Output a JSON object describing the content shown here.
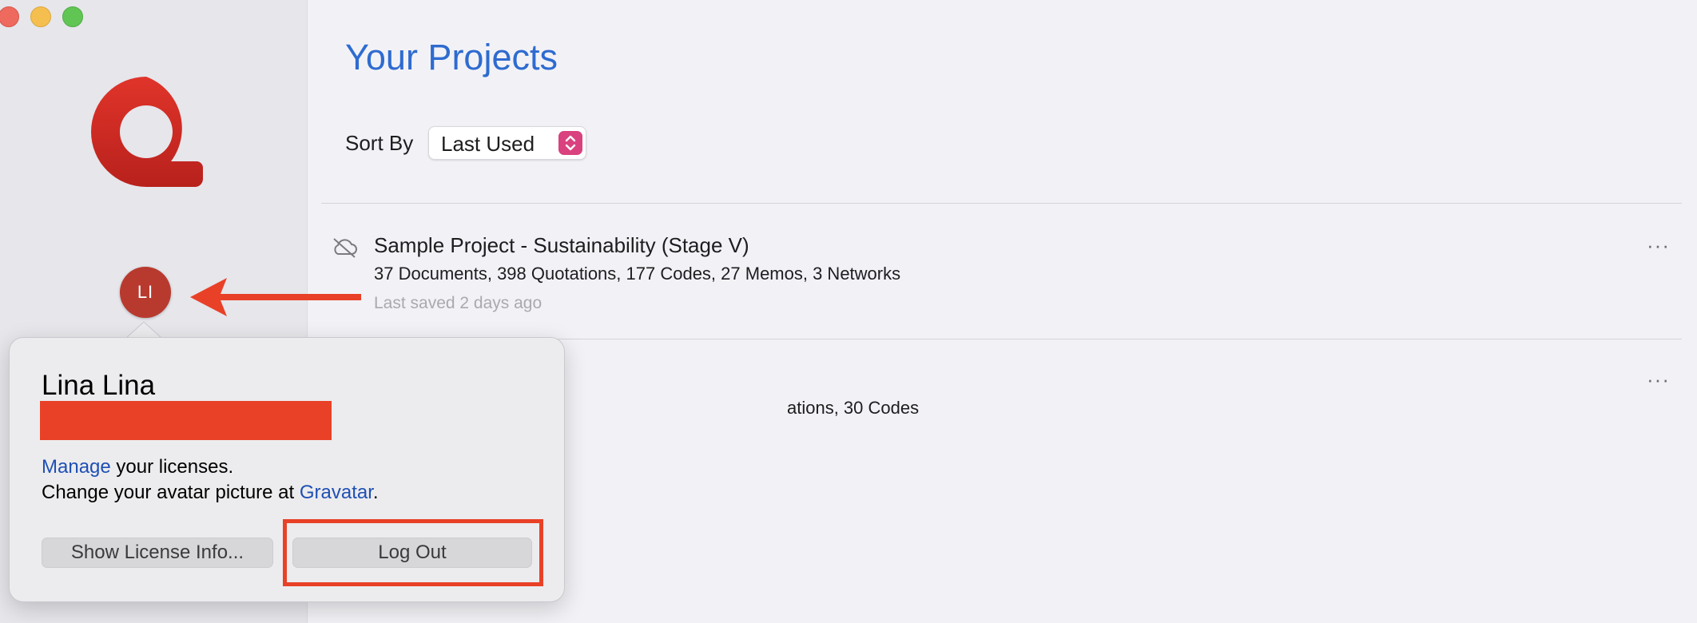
{
  "window": {
    "controls": [
      "close",
      "minimize",
      "zoom"
    ]
  },
  "sidebar": {
    "logo_icon": "atlas-at-logo-icon",
    "avatar_initials": "LI"
  },
  "main": {
    "title": "Your Projects",
    "sort_label": "Sort By",
    "sort_value": "Last Used",
    "projects": [
      {
        "name": "Sample Project - Sustainability (Stage V)",
        "stats": "37 Documents, 398 Quotations, 177 Codes, 27 Memos, 3 Networks",
        "saved": "Last saved 2 days ago",
        "icon": "cloud-off-icon",
        "more": "···"
      },
      {
        "stats_visible": "ations, 30 Codes",
        "more": "···"
      }
    ]
  },
  "popover": {
    "user_name": "Lina Lina",
    "manage_link": "Manage",
    "manage_rest": " your licenses.",
    "avatar_prefix": "Change your avatar picture at ",
    "gravatar_link": "Gravatar",
    "avatar_suffix": ".",
    "show_license_button": "Show License Info...",
    "logout_button": "Log Out"
  },
  "colors": {
    "accent_title": "#2e6bd0",
    "annotation_red": "#e84127",
    "avatar_bg": "#b83a2e",
    "link": "#1f4fb3",
    "stepper": "#d9427e"
  }
}
